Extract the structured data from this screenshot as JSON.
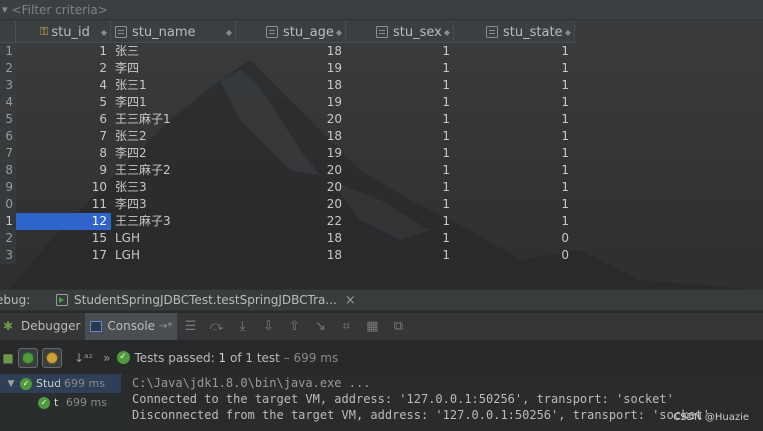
{
  "filter": {
    "placeholder": "<Filter criteria>"
  },
  "table": {
    "columns": [
      {
        "key": "id",
        "label": "stu_id"
      },
      {
        "key": "name",
        "label": "stu_name"
      },
      {
        "key": "age",
        "label": "stu_age"
      },
      {
        "key": "sex",
        "label": "stu_sex"
      },
      {
        "key": "state",
        "label": "stu_state"
      }
    ],
    "rows": [
      {
        "num": "1",
        "id": "1",
        "name": "张三",
        "age": "18",
        "sex": "1",
        "state": "1"
      },
      {
        "num": "2",
        "id": "2",
        "name": "李四",
        "age": "19",
        "sex": "1",
        "state": "1"
      },
      {
        "num": "3",
        "id": "4",
        "name": "张三1",
        "age": "18",
        "sex": "1",
        "state": "1"
      },
      {
        "num": "4",
        "id": "5",
        "name": "李四1",
        "age": "19",
        "sex": "1",
        "state": "1"
      },
      {
        "num": "5",
        "id": "6",
        "name": "王三麻子1",
        "age": "20",
        "sex": "1",
        "state": "1"
      },
      {
        "num": "6",
        "id": "7",
        "name": "张三2",
        "age": "18",
        "sex": "1",
        "state": "1"
      },
      {
        "num": "7",
        "id": "8",
        "name": "李四2",
        "age": "19",
        "sex": "1",
        "state": "1"
      },
      {
        "num": "8",
        "id": "9",
        "name": "王三麻子2",
        "age": "20",
        "sex": "1",
        "state": "1"
      },
      {
        "num": "9",
        "id": "10",
        "name": "张三3",
        "age": "20",
        "sex": "1",
        "state": "1"
      },
      {
        "num": "0",
        "id": "11",
        "name": "李四3",
        "age": "20",
        "sex": "1",
        "state": "1"
      },
      {
        "num": "1",
        "id": "12",
        "name": "王三麻子3",
        "age": "22",
        "sex": "1",
        "state": "1",
        "selected": true
      },
      {
        "num": "2",
        "id": "15",
        "name": "LGH",
        "age": "18",
        "sex": "1",
        "state": "0"
      },
      {
        "num": "3",
        "id": "17",
        "name": "LGH",
        "age": "18",
        "sex": "1",
        "state": "0"
      }
    ]
  },
  "debug": {
    "label": "ebug:",
    "tab_title": "StudentSpringJDBCTest.testSpringJDBCTra..."
  },
  "toolbar": {
    "debugger_label": "Debugger",
    "console_label": "Console",
    "pin_label": "→*"
  },
  "tests": {
    "passed_label": "Tests passed:",
    "count": "1",
    "of_label": "of 1 test",
    "duration": "– 699 ms"
  },
  "tree": [
    {
      "name": "Stud",
      "time": "699 ms"
    },
    {
      "name": "t",
      "time": "699 ms"
    }
  ],
  "console": {
    "lines": [
      "C:\\Java\\jdk1.8.0\\bin\\java.exe ...",
      "Connected to the target VM, address: '127.0.0.1:50256', transport: 'socket'",
      "Disconnected from the target VM, address: '127.0.0.1:50256', transport: 'socket'"
    ]
  },
  "watermark": "CSDN @Huazie",
  "colors": {
    "selection": "#2f65ca",
    "pass_green": "#4e9a3c",
    "key_gold": "#d8b24a"
  }
}
